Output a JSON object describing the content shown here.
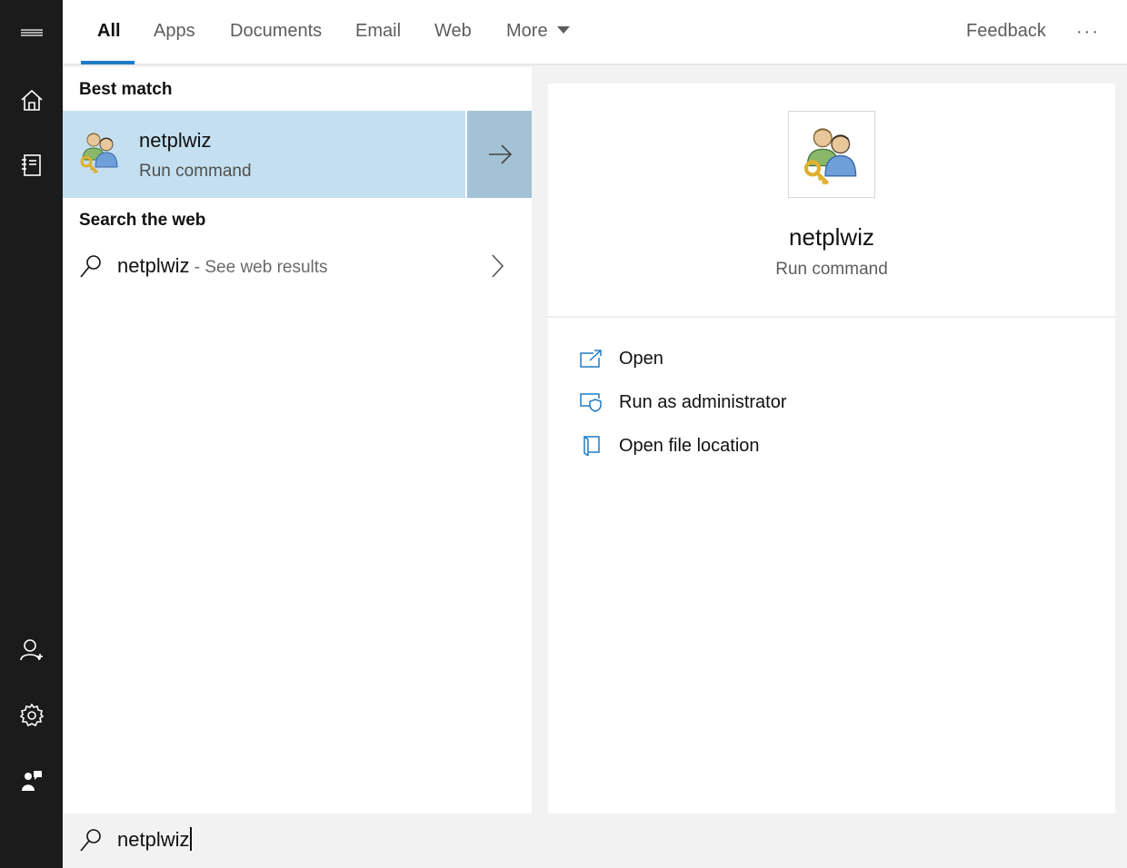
{
  "tabs": [
    {
      "label": "All",
      "active": true
    },
    {
      "label": "Apps"
    },
    {
      "label": "Documents"
    },
    {
      "label": "Email"
    },
    {
      "label": "Web"
    },
    {
      "label": "More"
    }
  ],
  "header": {
    "feedback_label": "Feedback",
    "more_options": "···"
  },
  "results": {
    "best_match_heading": "Best match",
    "best_match": {
      "title": "netplwiz",
      "subtitle": "Run command",
      "icon": "users-key-icon"
    },
    "web_heading": "Search the web",
    "web_result": {
      "query": "netplwiz",
      "suffix": " - See web results"
    }
  },
  "detail": {
    "title": "netplwiz",
    "subtitle": "Run command",
    "actions": [
      {
        "label": "Open",
        "icon": "open-icon"
      },
      {
        "label": "Run as administrator",
        "icon": "run-as-admin-icon"
      },
      {
        "label": "Open file location",
        "icon": "file-location-icon"
      }
    ]
  },
  "search": {
    "value": "netplwiz"
  },
  "sidebar": {
    "items": [
      "hamburger-menu-icon",
      "home-icon",
      "notebook-icon",
      "account-icon",
      "settings-icon",
      "feedback-person-icon"
    ]
  },
  "colors": {
    "accent": "#1e7cc6",
    "selected_row": "#c3dff0",
    "selected_arrow": "#a4c2d5",
    "rail": "#1b1b1b"
  }
}
